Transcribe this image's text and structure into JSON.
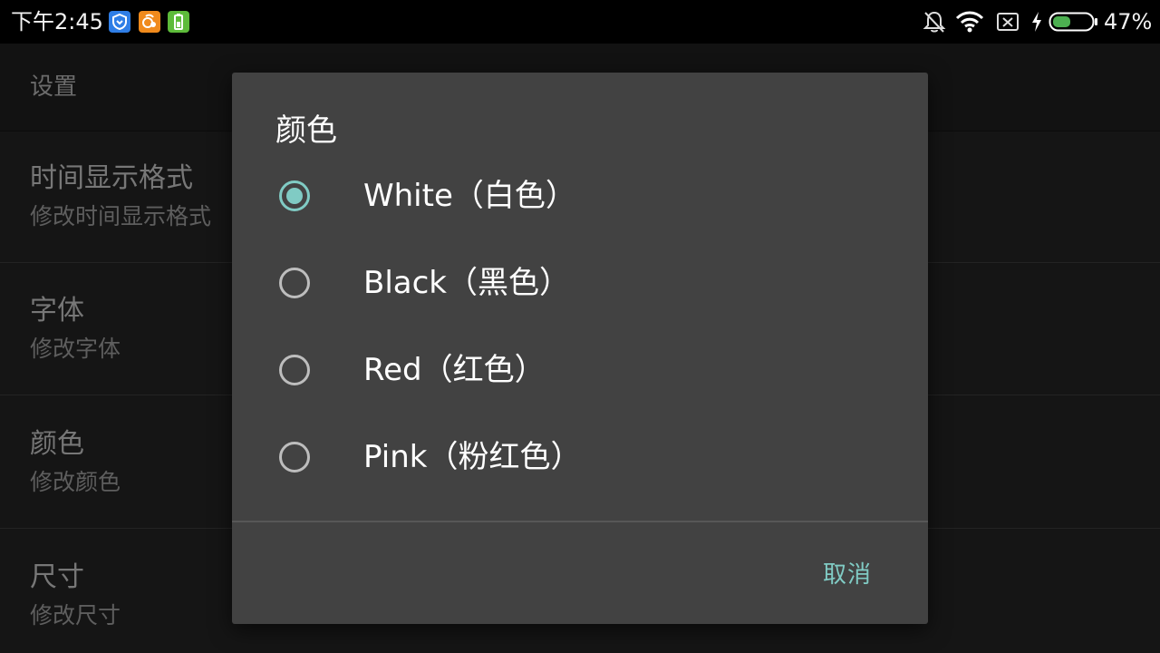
{
  "status_bar": {
    "time": "下午2:45",
    "battery_percent": "47%",
    "battery_level": 0.47,
    "left_icons": [
      "shield-app-icon",
      "uc-browser-icon",
      "battery-saver-app-icon"
    ],
    "right_icons": [
      "notifications-off-icon",
      "wifi-icon",
      "no-sim-icon",
      "charging-bolt-icon",
      "battery-icon"
    ]
  },
  "appbar": {
    "title": "设置"
  },
  "settings": {
    "items": [
      {
        "title": "时间显示格式",
        "subtitle": "修改时间显示格式"
      },
      {
        "title": "字体",
        "subtitle": "修改字体"
      },
      {
        "title": "颜色",
        "subtitle": "修改颜色"
      },
      {
        "title": "尺寸",
        "subtitle": "修改尺寸"
      }
    ]
  },
  "dialog": {
    "title": "颜色",
    "options": [
      {
        "label": "White（白色）",
        "checked": true
      },
      {
        "label": "Black（黑色）",
        "checked": false
      },
      {
        "label": "Red（红色）",
        "checked": false
      },
      {
        "label": "Pink（粉红色）",
        "checked": false
      }
    ],
    "cancel_label": "取消"
  },
  "colors": {
    "accent": "#80cbc4",
    "dialog_bg": "#424242",
    "status_bar_bg": "#000000",
    "battery_fill": "#4caf50"
  }
}
